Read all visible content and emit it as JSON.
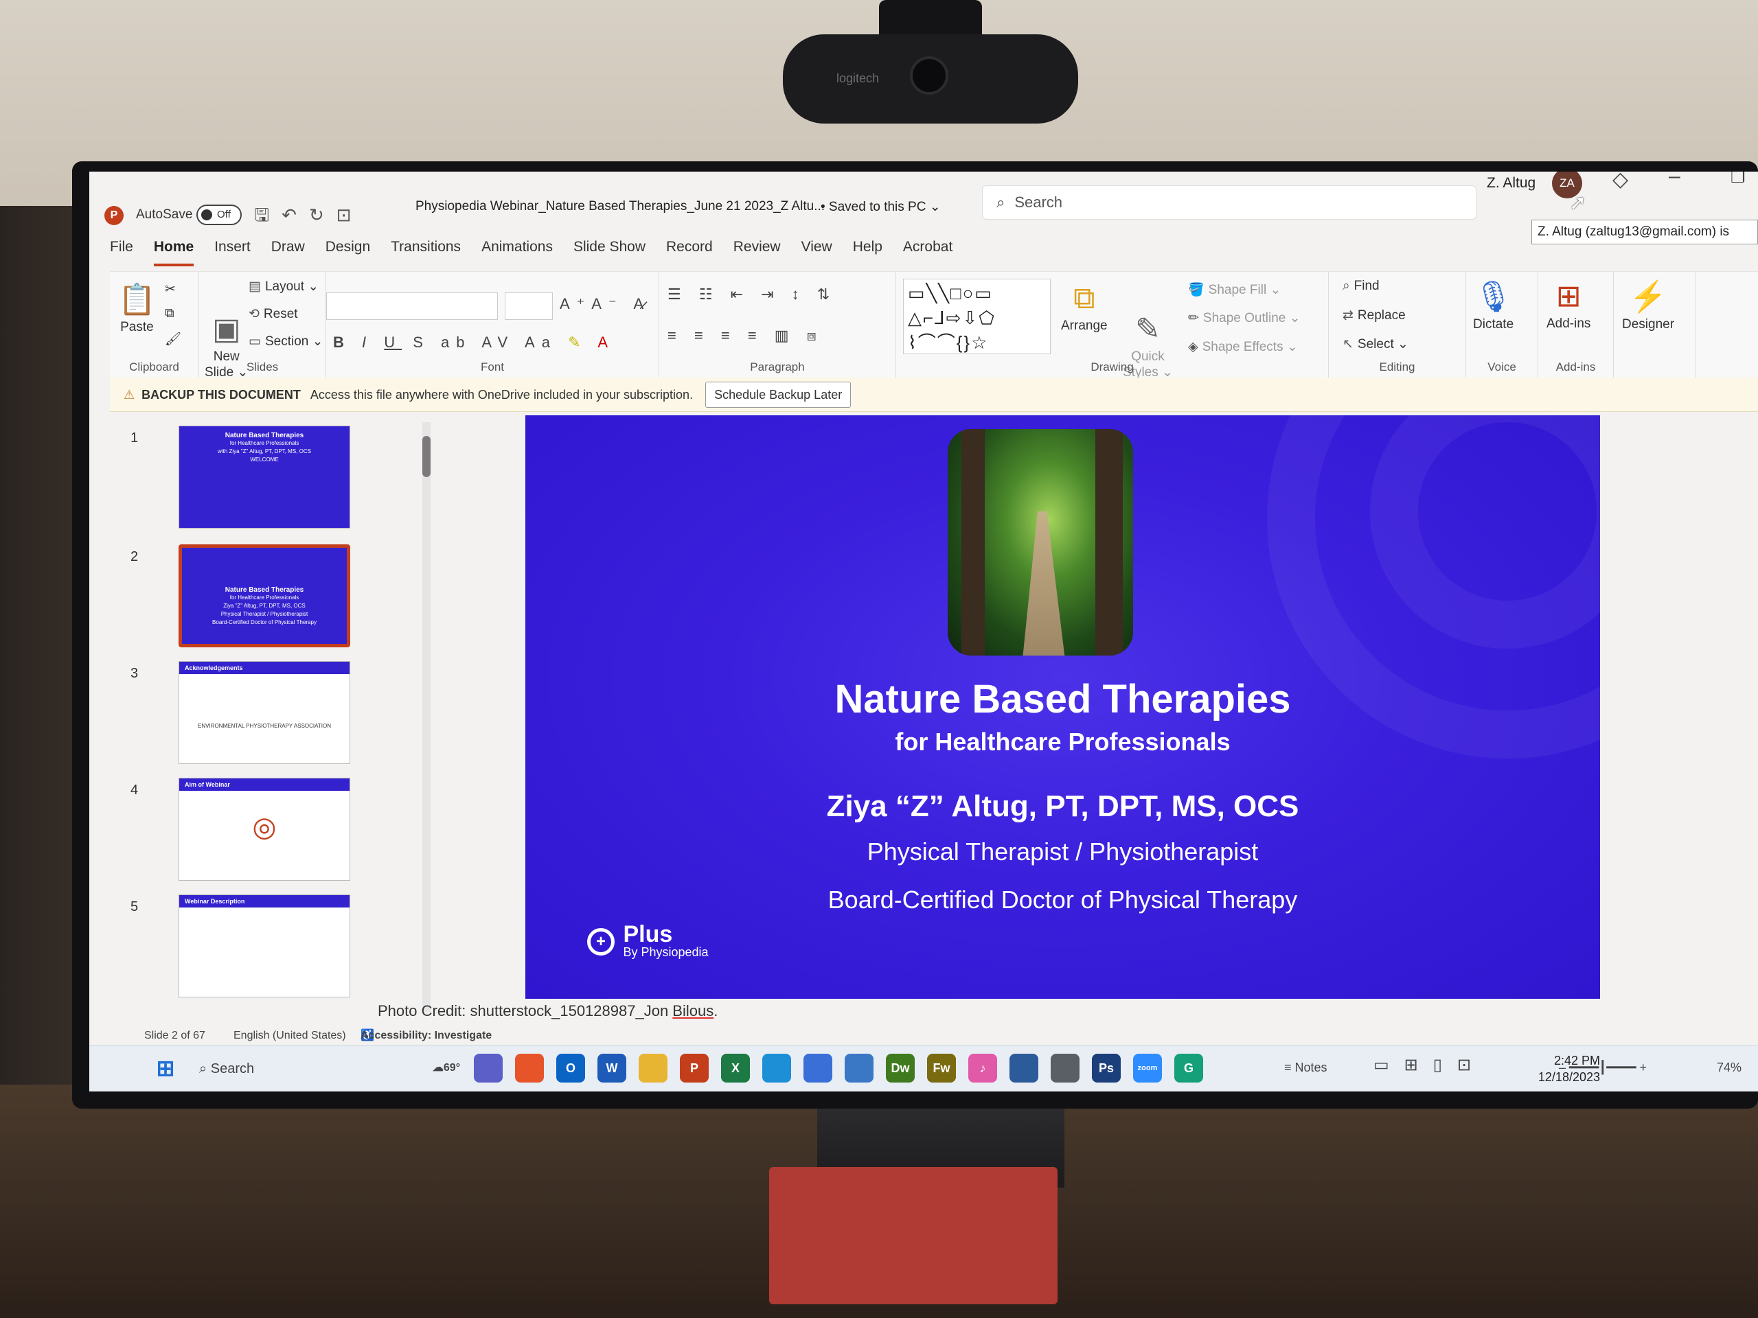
{
  "webcam_brand": "logitech",
  "titlebar": {
    "app_icon": "P",
    "autosave_label": "AutoSave",
    "autosave_state": "Off",
    "document_title": "Physiopedia Webinar_Nature Based Therapies_June 21 2023_Z Altu...",
    "save_status": "• Saved to this PC ⌄",
    "search_placeholder": "Search",
    "user_name": "Z. Altug",
    "user_initials": "ZA",
    "tooltip": "Z. Altug (zaltug13@gmail.com) is"
  },
  "tabs": [
    {
      "label": "File"
    },
    {
      "label": "Home"
    },
    {
      "label": "Insert"
    },
    {
      "label": "Draw"
    },
    {
      "label": "Design"
    },
    {
      "label": "Transitions"
    },
    {
      "label": "Animations"
    },
    {
      "label": "Slide Show"
    },
    {
      "label": "Record"
    },
    {
      "label": "Review"
    },
    {
      "label": "View"
    },
    {
      "label": "Help"
    },
    {
      "label": "Acrobat"
    }
  ],
  "ribbon": {
    "clipboard": {
      "paste": "Paste",
      "label": "Clipboard"
    },
    "slides": {
      "new_slide": "New\nSlide ⌄",
      "layout": "Layout ⌄",
      "reset": "Reset",
      "section": "Section ⌄",
      "label": "Slides"
    },
    "font": {
      "label": "Font"
    },
    "paragraph": {
      "label": "Paragraph"
    },
    "drawing": {
      "arrange": "Arrange",
      "quick_styles": "Quick\nStyles ⌄",
      "shape_fill": "Shape Fill ⌄",
      "shape_outline": "Shape Outline ⌄",
      "shape_effects": "Shape Effects ⌄",
      "label": "Drawing"
    },
    "editing": {
      "find": "Find",
      "replace": "Replace",
      "select": "Select ⌄",
      "label": "Editing"
    },
    "voice": {
      "dictate": "Dictate",
      "label": "Voice"
    },
    "addins": {
      "addins": "Add-ins",
      "label": "Add-ins"
    },
    "designer": {
      "designer": "Designer"
    }
  },
  "notification": {
    "title": "BACKUP THIS DOCUMENT",
    "message": "Access this file anywhere with OneDrive included in your subscription.",
    "button": "Schedule Backup Later"
  },
  "thumbnails": [
    {
      "num": "1",
      "title": "Nature Based Therapies",
      "sub": "for Healthcare Professionals\nwith Ziya \"Z\" Altug, PT, DPT, MS, OCS\nWELCOME"
    },
    {
      "num": "2",
      "title": "Nature Based Therapies",
      "sub": "for Healthcare Professionals\nZiya \"Z\" Altug, PT, DPT, MS, OCS\nPhysical Therapist / Physiotherapist\nBoard-Certified Doctor of Physical Therapy"
    },
    {
      "num": "3",
      "title": "Acknowledgements",
      "sub": "ENVIRONMENTAL PHYSIOTHERAPY ASSOCIATION"
    },
    {
      "num": "4",
      "title": "Aim of Webinar",
      "sub": ""
    },
    {
      "num": "5",
      "title": "Webinar Description",
      "sub": ""
    }
  ],
  "slide": {
    "title": "Nature Based Therapies",
    "subtitle": "for Healthcare Professionals",
    "presenter": "Ziya “Z” Altug, PT, DPT, MS, OCS",
    "role": "Physical Therapist / Physiotherapist",
    "credential": "Board-Certified Doctor of Physical Therapy",
    "logo_name": "Plus",
    "logo_by": "By Physiopedia"
  },
  "notes": {
    "prefix": "Photo Credit: shutterstock_150128987_Jon ",
    "underlined": "Bilous",
    "suffix": "."
  },
  "status": {
    "slide_count": "Slide 2 of 67",
    "language": "English (United States)",
    "accessibility": "Accessibility: Investigate",
    "notes": "Notes",
    "zoom": "74%"
  },
  "taskbar": {
    "search": "Search",
    "weather": "69°",
    "time": "2:42 PM",
    "date": "12/18/2023",
    "apps": [
      {
        "name": "teams-icon",
        "glyph": "",
        "color": "#5b5fc7"
      },
      {
        "name": "firefox-icon",
        "glyph": "",
        "color": "#e8542a"
      },
      {
        "name": "outlook-icon",
        "glyph": "O",
        "color": "#0a64c4"
      },
      {
        "name": "word-icon",
        "glyph": "W",
        "color": "#1e5bb8"
      },
      {
        "name": "file-explorer-icon",
        "glyph": "",
        "color": "#e8b533"
      },
      {
        "name": "powerpoint-icon",
        "glyph": "P",
        "color": "#c43e1c"
      },
      {
        "name": "excel-icon",
        "glyph": "X",
        "color": "#1d7a44"
      },
      {
        "name": "edge-icon",
        "glyph": "",
        "color": "#1c8fd6"
      },
      {
        "name": "store-icon",
        "glyph": "",
        "color": "#3b6fd8"
      },
      {
        "name": "calculator-icon",
        "glyph": "",
        "color": "#3a78c6"
      },
      {
        "name": "dreamweaver-icon",
        "glyph": "Dw",
        "color": "#3f7a1e"
      },
      {
        "name": "fireworks-icon",
        "glyph": "Fw",
        "color": "#7a6a10"
      },
      {
        "name": "itunes-icon",
        "glyph": "♪",
        "color": "#e05aa8"
      },
      {
        "name": "video-editor-icon",
        "glyph": "",
        "color": "#2c5b9a"
      },
      {
        "name": "camera-icon",
        "glyph": "",
        "color": "#5a5f66"
      },
      {
        "name": "photoshop-icon",
        "glyph": "Ps",
        "color": "#1b3f7a"
      },
      {
        "name": "zoom-icon",
        "glyph": "zoom",
        "color": "#2d8cff"
      },
      {
        "name": "grammarly-icon",
        "glyph": "G",
        "color": "#15a07a"
      }
    ]
  }
}
